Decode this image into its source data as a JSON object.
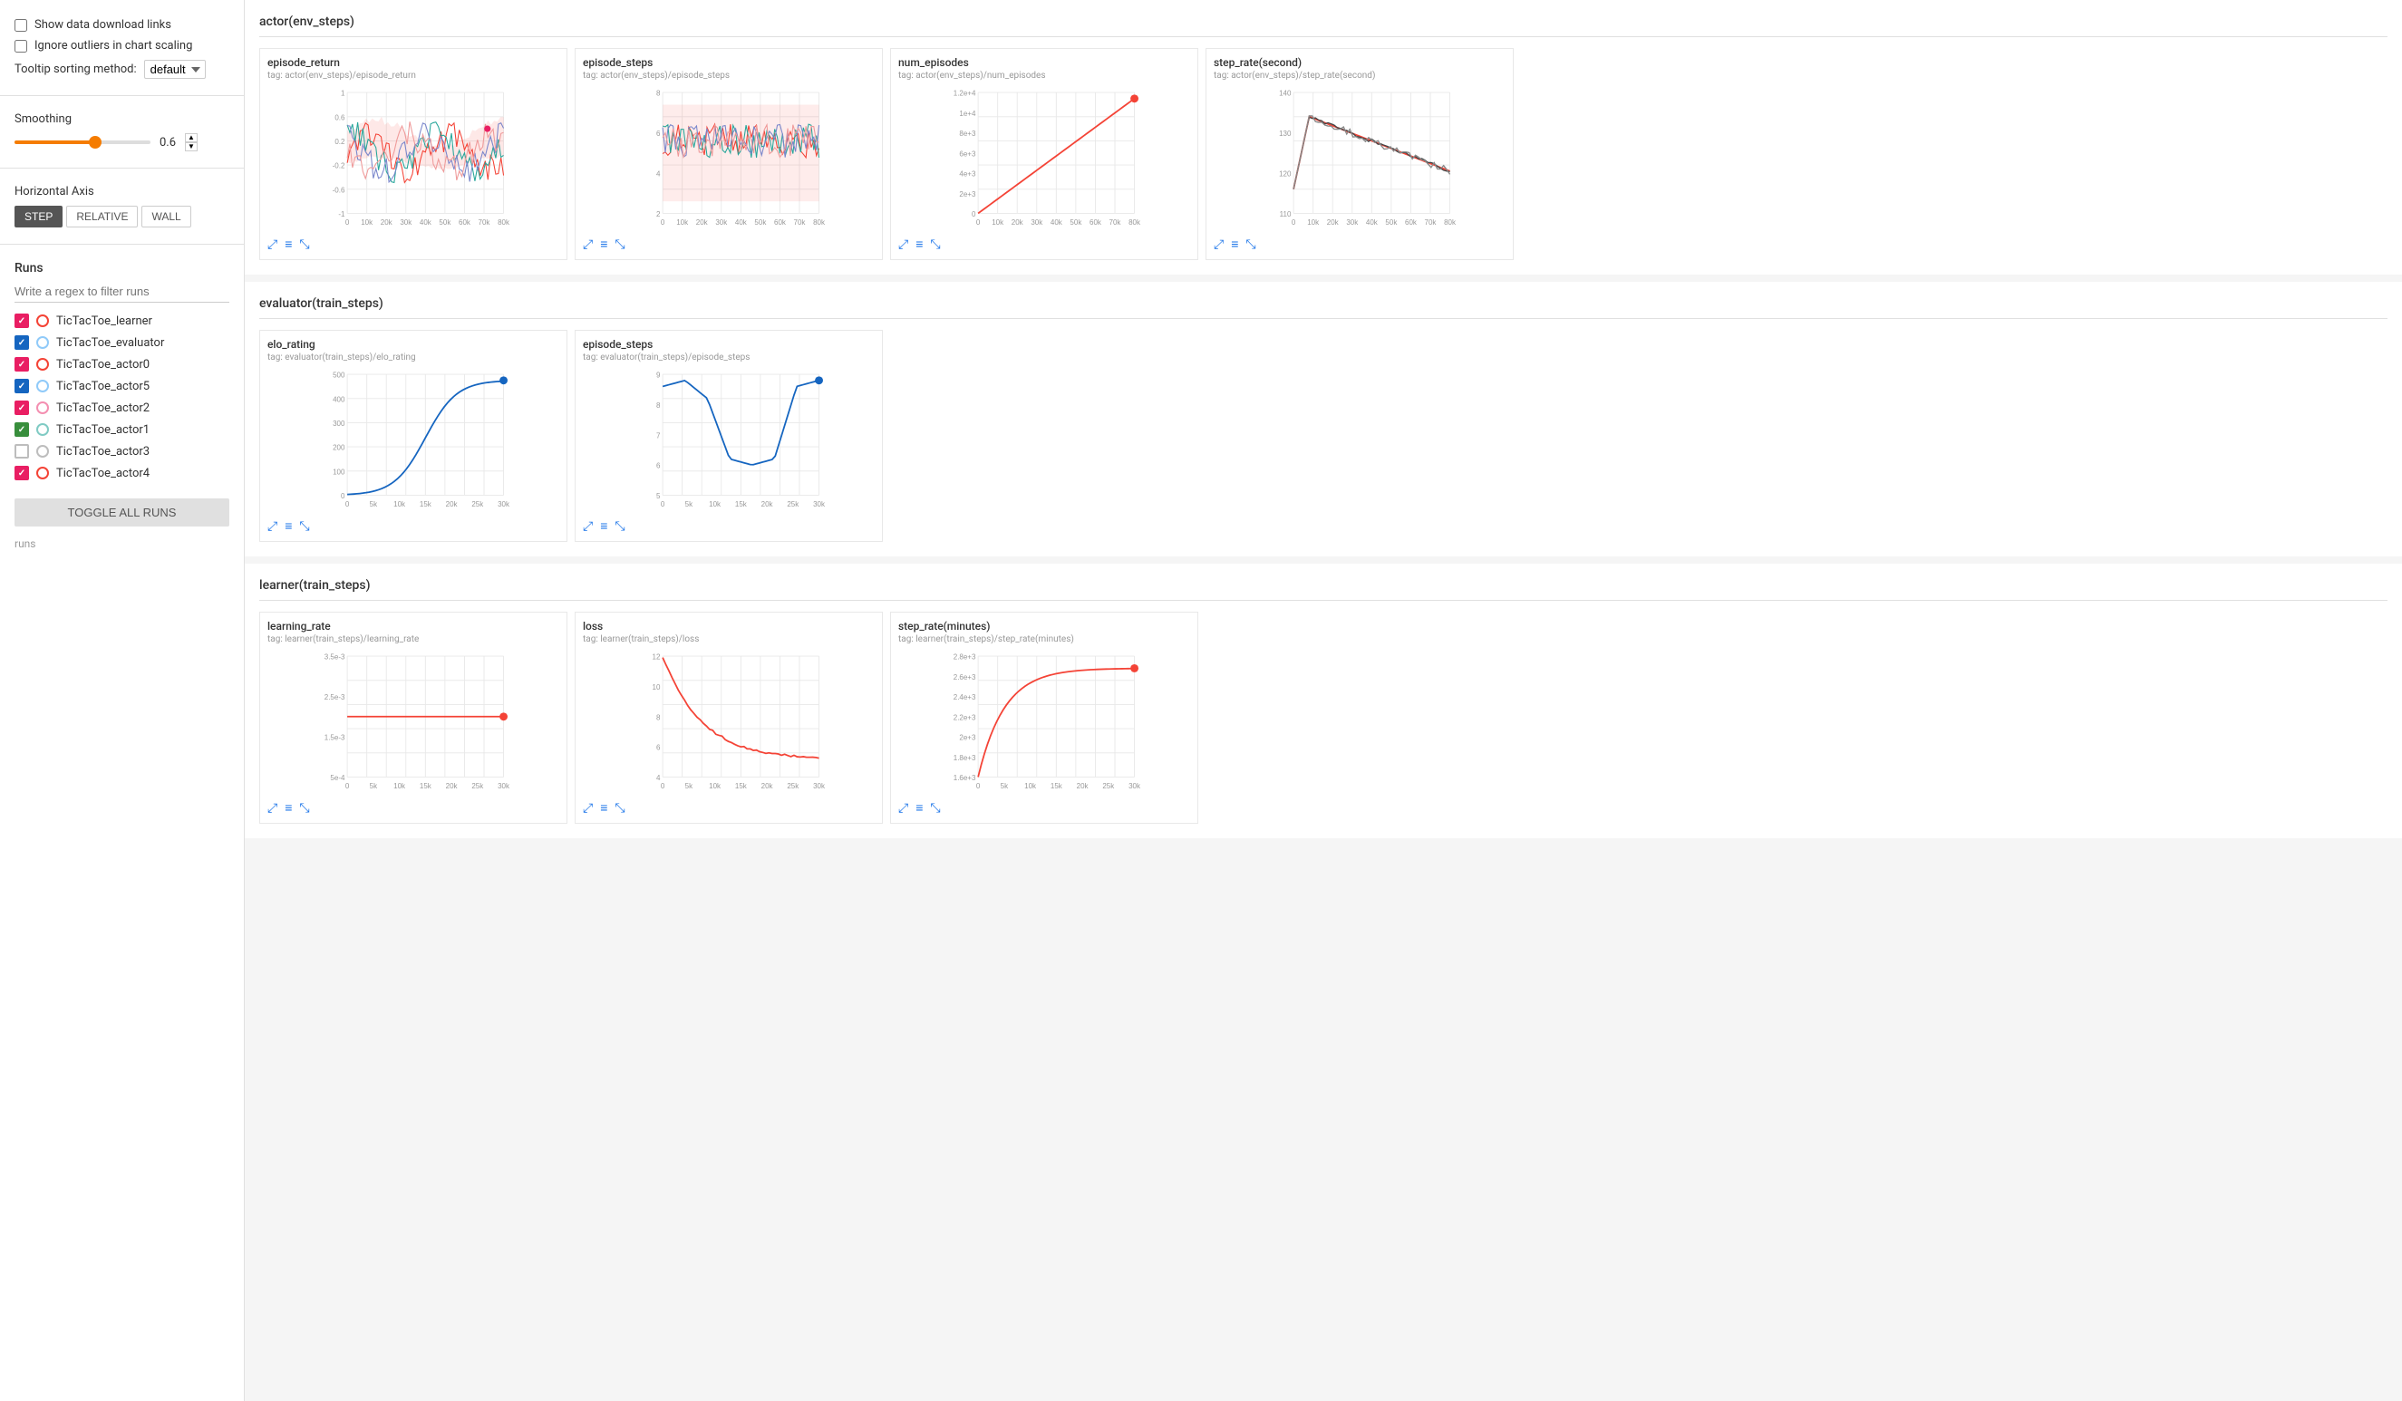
{
  "sidebar": {
    "show_data_links_label": "Show data download links",
    "ignore_outliers_label": "Ignore outliers in chart scaling",
    "tooltip_sort_label": "Tooltip sorting method:",
    "tooltip_sort_value": "default",
    "smoothing_label": "Smoothing",
    "smoothing_value": "0.6",
    "h_axis_label": "Horizontal Axis",
    "axis_buttons": [
      "STEP",
      "RELATIVE",
      "WALL"
    ],
    "active_axis": "STEP",
    "runs_title": "Runs",
    "filter_placeholder": "Write a regex to filter runs",
    "toggle_all_label": "TOGGLE ALL RUNS",
    "runs_footer": "runs",
    "runs": [
      {
        "name": "TicTacToe_learner",
        "checked": true,
        "box_color": "#e91e63",
        "circle_color": "#f44336",
        "circle_border": "#f44336"
      },
      {
        "name": "TicTacToe_evaluator",
        "checked": true,
        "box_color": "#1565c0",
        "circle_color": "#90caf9",
        "circle_border": "#90caf9"
      },
      {
        "name": "TicTacToe_actor0",
        "checked": true,
        "box_color": "#e91e63",
        "circle_color": "#f44336",
        "circle_border": "#f44336"
      },
      {
        "name": "TicTacToe_actor5",
        "checked": true,
        "box_color": "#1565c0",
        "circle_color": "#90caf9",
        "circle_border": "#90caf9"
      },
      {
        "name": "TicTacToe_actor2",
        "checked": true,
        "box_color": "#e91e63",
        "circle_color": "#f48fb1",
        "circle_border": "#f48fb1"
      },
      {
        "name": "TicTacToe_actor1",
        "checked": true,
        "box_color": "#388e3c",
        "circle_color": "#80cbc4",
        "circle_border": "#80cbc4"
      },
      {
        "name": "TicTacToe_actor3",
        "checked": false,
        "box_color": "#bdbdbd",
        "circle_color": "#bdbdbd",
        "circle_border": "#bdbdbd"
      },
      {
        "name": "TicTacToe_actor4",
        "checked": true,
        "box_color": "#e91e63",
        "circle_color": "#f44336",
        "circle_border": "#f44336"
      }
    ]
  },
  "sections": [
    {
      "id": "actor_env_steps",
      "title": "actor(env_steps)",
      "charts": [
        {
          "id": "episode_return",
          "title": "episode_return",
          "tag": "tag: actor(env_steps)/episode_return",
          "type": "multi_noisy",
          "x_labels": [
            "0",
            "10k",
            "20k",
            "30k",
            "40k",
            "50k",
            "60k",
            "70k",
            "80k"
          ],
          "y_labels": [
            "1",
            "0.6",
            "0.2",
            "-0.2",
            "-0.6",
            "-1"
          ],
          "color": "#f44336"
        },
        {
          "id": "episode_steps",
          "title": "episode_steps",
          "tag": "tag: actor(env_steps)/episode_steps",
          "type": "multi_noisy2",
          "x_labels": [
            "0",
            "10k",
            "20k",
            "30k",
            "40k",
            "50k",
            "60k",
            "70k",
            "80k"
          ],
          "y_labels": [
            "8",
            "6",
            "4",
            "2"
          ],
          "color": "#f44336"
        },
        {
          "id": "num_episodes",
          "title": "num_episodes",
          "tag": "tag: actor(env_steps)/num_episodes",
          "type": "linear_rising",
          "x_labels": [
            "0",
            "10k",
            "20k",
            "30k",
            "40k",
            "50k",
            "60k",
            "70k",
            "80k"
          ],
          "y_labels": [
            "1.2e+4",
            "1e+4",
            "8e+3",
            "6e+3",
            "4e+3",
            "2e+3",
            "0"
          ],
          "color": "#f44336"
        },
        {
          "id": "step_rate_second",
          "title": "step_rate(second)",
          "tag": "tag: actor(env_steps)/step_rate(second)",
          "type": "peak_decay",
          "x_labels": [
            "0",
            "10k",
            "20k",
            "30k",
            "40k",
            "50k",
            "60k",
            "70k",
            "80k"
          ],
          "y_labels": [
            "140",
            "130",
            "120",
            "110"
          ],
          "color": "#f44336"
        }
      ]
    },
    {
      "id": "evaluator_train_steps",
      "title": "evaluator(train_steps)",
      "charts": [
        {
          "id": "elo_rating",
          "title": "elo_rating",
          "tag": "tag: evaluator(train_steps)/elo_rating",
          "type": "elo_curve",
          "x_labels": [
            "0",
            "5k",
            "10k",
            "15k",
            "20k",
            "25k",
            "30k"
          ],
          "y_labels": [
            "500",
            "400",
            "300",
            "200",
            "100",
            "0"
          ],
          "color": "#1565c0"
        },
        {
          "id": "eval_episode_steps",
          "title": "episode_steps",
          "tag": "tag: evaluator(train_steps)/episode_steps",
          "type": "eval_steps_curve",
          "x_labels": [
            "0",
            "5k",
            "10k",
            "15k",
            "20k",
            "25k",
            "30k"
          ],
          "y_labels": [
            "9",
            "8",
            "7",
            "6",
            "5"
          ],
          "color": "#1565c0"
        }
      ]
    },
    {
      "id": "learner_train_steps",
      "title": "learner(train_steps)",
      "charts": [
        {
          "id": "learning_rate",
          "title": "learning_rate",
          "tag": "tag: learner(train_steps)/learning_rate",
          "type": "flat_lr",
          "x_labels": [
            "0",
            "5k",
            "10k",
            "15k",
            "20k",
            "25k",
            "30k"
          ],
          "y_labels": [
            "3.5e-3",
            "2.5e-3",
            "1.5e-3",
            "5e-4"
          ],
          "color": "#f44336"
        },
        {
          "id": "loss",
          "title": "loss",
          "tag": "tag: learner(train_steps)/loss",
          "type": "loss_decay",
          "x_labels": [
            "0",
            "5k",
            "10k",
            "15k",
            "20k",
            "25k",
            "30k"
          ],
          "y_labels": [
            "12",
            "10",
            "8",
            "6",
            "4"
          ],
          "color": "#f44336"
        },
        {
          "id": "step_rate_minutes",
          "title": "step_rate(minutes)",
          "tag": "tag: learner(train_steps)/step_rate(minutes)",
          "type": "step_rate_rise",
          "x_labels": [
            "0",
            "5k",
            "10k",
            "15k",
            "20k",
            "25k",
            "30k"
          ],
          "y_labels": [
            "2.8e+3",
            "2.6e+3",
            "2.4e+3",
            "2.2e+3",
            "2e+3",
            "1.8e+3",
            "1.6e+3"
          ],
          "color": "#f44336"
        }
      ]
    }
  ]
}
